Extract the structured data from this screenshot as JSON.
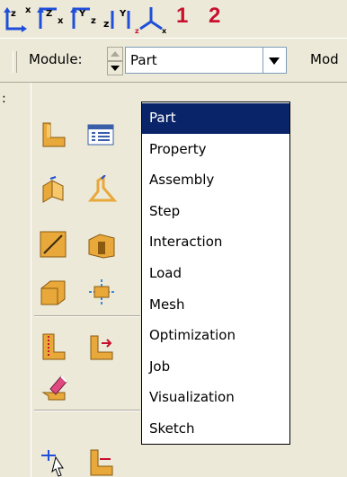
{
  "view_toolbar": {
    "buttons": [
      {
        "icon": "view-axes-zx-icon"
      },
      {
        "icon": "view-axes-zx-alt-icon"
      },
      {
        "icon": "view-axes-yz-icon"
      },
      {
        "icon": "view-axes-zy-icon"
      },
      {
        "icon": "view-iso-xyz-icon"
      }
    ],
    "numbers": [
      "1",
      "2"
    ],
    "accent_color": "#C8102E"
  },
  "module_bar": {
    "module_label": "Module:",
    "module_selected": "Part",
    "second_label_partial": "Mod"
  },
  "module_dropdown": {
    "selected_index": 0,
    "options": [
      "Part",
      "Property",
      "Assembly",
      "Step",
      "Interaction",
      "Load",
      "Mesh",
      "Optimization",
      "Job",
      "Visualization",
      "Sketch"
    ],
    "highlight_color": "#0A246A"
  },
  "toolbox": {
    "tools": [
      "create-part-icon",
      "part-manager-icon",
      "create-solid-extrude-icon",
      "create-shell-extrude-icon",
      "create-wire-icon",
      "create-cut-extrude-icon",
      "create-round-fillet-icon",
      "create-datum-icon",
      "partition-face-icon",
      "partition-edge-icon",
      "create-virtual-topology-icon",
      "query-icon",
      "create-set-icon"
    ]
  }
}
